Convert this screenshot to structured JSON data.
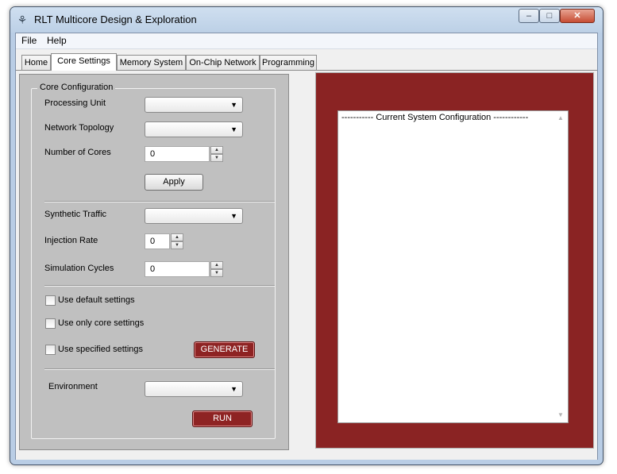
{
  "window": {
    "title": "RLT Multicore Design & Exploration",
    "app_icon_glyph": "⚘",
    "controls": {
      "minimize": "–",
      "maximize": "□",
      "close": "✕"
    }
  },
  "menubar": {
    "items": [
      "File",
      "Help"
    ]
  },
  "tabs": [
    {
      "label": "Home",
      "active": false
    },
    {
      "label": "Core Settings",
      "active": true
    },
    {
      "label": "Memory System",
      "active": false
    },
    {
      "label": "On-Chip Network",
      "active": false
    },
    {
      "label": "Programming",
      "active": false
    }
  ],
  "core_config": {
    "group_title": "Core Configuration",
    "processing_unit": {
      "label": "Processing Unit",
      "value": ""
    },
    "network_topology": {
      "label": "Network Topology",
      "value": ""
    },
    "number_of_cores": {
      "label": "Number of Cores",
      "value": "0"
    },
    "apply_label": "Apply",
    "synthetic_traffic": {
      "label": "Synthetic Traffic",
      "value": ""
    },
    "injection_rate": {
      "label": "Injection Rate",
      "value": "0"
    },
    "simulation_cycles": {
      "label": "Simulation Cycles",
      "value": "0"
    },
    "use_default": {
      "label": "Use default settings",
      "checked": false
    },
    "use_core_only": {
      "label": "Use only core settings",
      "checked": false
    },
    "use_specified": {
      "label": "Use specified settings",
      "checked": false
    },
    "generate_label": "GENERATE",
    "environment": {
      "label": "Environment",
      "value": ""
    },
    "run_label": "RUN"
  },
  "output": {
    "header": "----------- Current System Configuration ------------"
  },
  "icons": {
    "dropdown_arrow": "▼",
    "spin_up": "▲",
    "spin_down": "▼",
    "scroll_up": "▲",
    "scroll_down": "▼"
  },
  "colors": {
    "accent_red": "#8a2323",
    "panel_gray": "#c0c0c0",
    "titlebar": "#bcd0e6"
  }
}
